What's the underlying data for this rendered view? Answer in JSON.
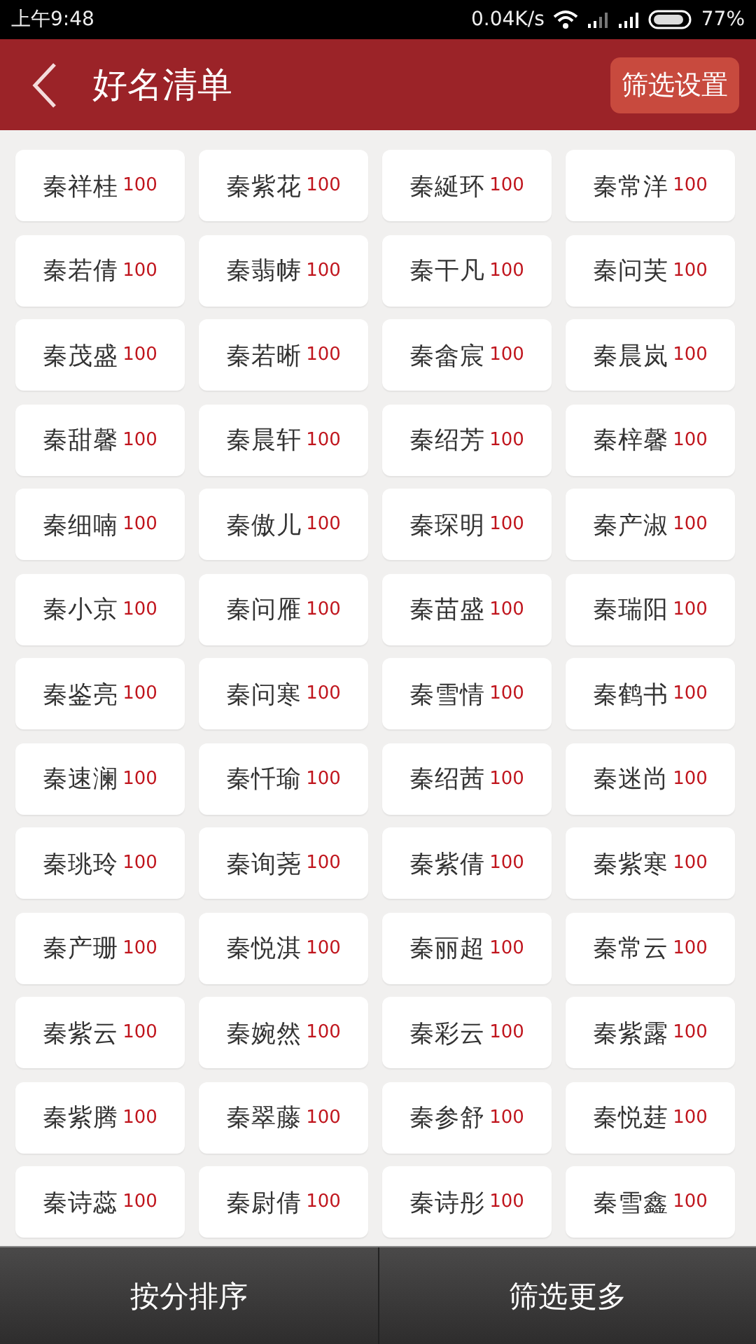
{
  "status_bar": {
    "time": "上午9:48",
    "network_speed": "0.04K/s",
    "battery": "77%"
  },
  "header": {
    "title": "好名清单",
    "action": "筛选设置"
  },
  "names": [
    {
      "name": "秦祥桂",
      "score": "100"
    },
    {
      "name": "秦紫花",
      "score": "100"
    },
    {
      "name": "秦綖环",
      "score": "100"
    },
    {
      "name": "秦常洋",
      "score": "100"
    },
    {
      "name": "秦若倩",
      "score": "100"
    },
    {
      "name": "秦翡帱",
      "score": "100"
    },
    {
      "name": "秦干凡",
      "score": "100"
    },
    {
      "name": "秦问芙",
      "score": "100"
    },
    {
      "name": "秦茂盛",
      "score": "100"
    },
    {
      "name": "秦若晰",
      "score": "100"
    },
    {
      "name": "秦畲宸",
      "score": "100"
    },
    {
      "name": "秦晨岚",
      "score": "100"
    },
    {
      "name": "秦甜馨",
      "score": "100"
    },
    {
      "name": "秦晨轩",
      "score": "100"
    },
    {
      "name": "秦绍芳",
      "score": "100"
    },
    {
      "name": "秦梓馨",
      "score": "100"
    },
    {
      "name": "秦细喃",
      "score": "100"
    },
    {
      "name": "秦傲儿",
      "score": "100"
    },
    {
      "name": "秦琛明",
      "score": "100"
    },
    {
      "name": "秦产淑",
      "score": "100"
    },
    {
      "name": "秦小京",
      "score": "100"
    },
    {
      "name": "秦问雁",
      "score": "100"
    },
    {
      "name": "秦苗盛",
      "score": "100"
    },
    {
      "name": "秦瑞阳",
      "score": "100"
    },
    {
      "name": "秦鉴亮",
      "score": "100"
    },
    {
      "name": "秦问寒",
      "score": "100"
    },
    {
      "name": "秦雪情",
      "score": "100"
    },
    {
      "name": "秦鹤书",
      "score": "100"
    },
    {
      "name": "秦速澜",
      "score": "100"
    },
    {
      "name": "秦忏瑜",
      "score": "100"
    },
    {
      "name": "秦绍茜",
      "score": "100"
    },
    {
      "name": "秦迷尚",
      "score": "100"
    },
    {
      "name": "秦珧玲",
      "score": "100"
    },
    {
      "name": "秦询荛",
      "score": "100"
    },
    {
      "name": "秦紫倩",
      "score": "100"
    },
    {
      "name": "秦紫寒",
      "score": "100"
    },
    {
      "name": "秦产珊",
      "score": "100"
    },
    {
      "name": "秦悦淇",
      "score": "100"
    },
    {
      "name": "秦丽超",
      "score": "100"
    },
    {
      "name": "秦常云",
      "score": "100"
    },
    {
      "name": "秦紫云",
      "score": "100"
    },
    {
      "name": "秦婉然",
      "score": "100"
    },
    {
      "name": "秦彩云",
      "score": "100"
    },
    {
      "name": "秦紫露",
      "score": "100"
    },
    {
      "name": "秦紫腾",
      "score": "100"
    },
    {
      "name": "秦翠藤",
      "score": "100"
    },
    {
      "name": "秦参舒",
      "score": "100"
    },
    {
      "name": "秦悦莛",
      "score": "100"
    },
    {
      "name": "秦诗蕊",
      "score": "100"
    },
    {
      "name": "秦尉倩",
      "score": "100"
    },
    {
      "name": "秦诗彤",
      "score": "100"
    },
    {
      "name": "秦雪鑫",
      "score": "100"
    }
  ],
  "bottom_bar": [
    "按分排序",
    "筛选更多"
  ]
}
